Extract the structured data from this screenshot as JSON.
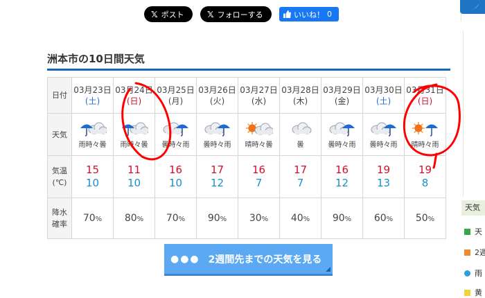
{
  "social": {
    "post": "ポスト",
    "follow": "フォローする",
    "like": "いいね！",
    "like_count": "0"
  },
  "heading": "洲本市の10日間天気",
  "labels": {
    "date": "日付",
    "weather": "天気",
    "temp1": "気温",
    "temp2": "(℃)",
    "rain1": "降水",
    "rain2": "確率"
  },
  "days": [
    {
      "date": "03月23日",
      "dow": "(土)",
      "dow_type": "sat",
      "icon": "rain-cloud-icon",
      "weather": "雨時々曇",
      "high": "15",
      "low": "10",
      "rain": "70",
      "unit": "%"
    },
    {
      "date": "03月24日",
      "dow": "(日)",
      "dow_type": "sun",
      "icon": "rain-cloud-icon",
      "weather": "雨時々曇",
      "high": "11",
      "low": "10",
      "rain": "80",
      "unit": "%"
    },
    {
      "date": "03月25日",
      "dow": "(月)",
      "dow_type": "wk",
      "icon": "cloud-rain-icon",
      "weather": "曇時々雨",
      "high": "16",
      "low": "10",
      "rain": "70",
      "unit": "%"
    },
    {
      "date": "03月26日",
      "dow": "(火)",
      "dow_type": "wk",
      "icon": "cloud-rain-icon",
      "weather": "曇時々雨",
      "high": "17",
      "low": "12",
      "rain": "90",
      "unit": "%"
    },
    {
      "date": "03月27日",
      "dow": "(水)",
      "dow_type": "wk",
      "icon": "sun-cloud-icon",
      "weather": "晴時々曇",
      "high": "16",
      "low": "7",
      "rain": "30",
      "unit": "%"
    },
    {
      "date": "03月28日",
      "dow": "(木)",
      "dow_type": "wk",
      "icon": "cloud-icon",
      "weather": "曇",
      "high": "17",
      "low": "7",
      "rain": "40",
      "unit": "%"
    },
    {
      "date": "03月29日",
      "dow": "(金)",
      "dow_type": "wk",
      "icon": "cloud-rain-icon",
      "weather": "曇時々雨",
      "high": "16",
      "low": "12",
      "rain": "90",
      "unit": "%"
    },
    {
      "date": "03月30日",
      "dow": "(土)",
      "dow_type": "sat",
      "icon": "cloud-rain-icon",
      "weather": "曇時々雨",
      "high": "19",
      "low": "13",
      "rain": "60",
      "unit": "%"
    },
    {
      "date": "03月31日",
      "dow": "(日)",
      "dow_type": "sun",
      "icon": "sun-rain-icon",
      "weather": "晴時々雨",
      "high": "19",
      "low": "8",
      "rain": "50",
      "unit": "%"
    }
  ],
  "cta": "2週間先までの天気を見る",
  "sidebar": {
    "label": "天気",
    "items": [
      {
        "text": "天",
        "color": "#3aa64a"
      },
      {
        "text": "2週",
        "color": "#f28a2e"
      },
      {
        "text": "雨",
        "color": "#2a9fd8"
      },
      {
        "text": "黄",
        "color": "#f2d43a"
      }
    ]
  },
  "colors": {
    "accent": "#1a66b8",
    "saturday": "#1f6fd0",
    "sunday": "#d0102a",
    "high": "#d0102a",
    "low": "#1a90c8",
    "annotation": "#ff0000"
  }
}
